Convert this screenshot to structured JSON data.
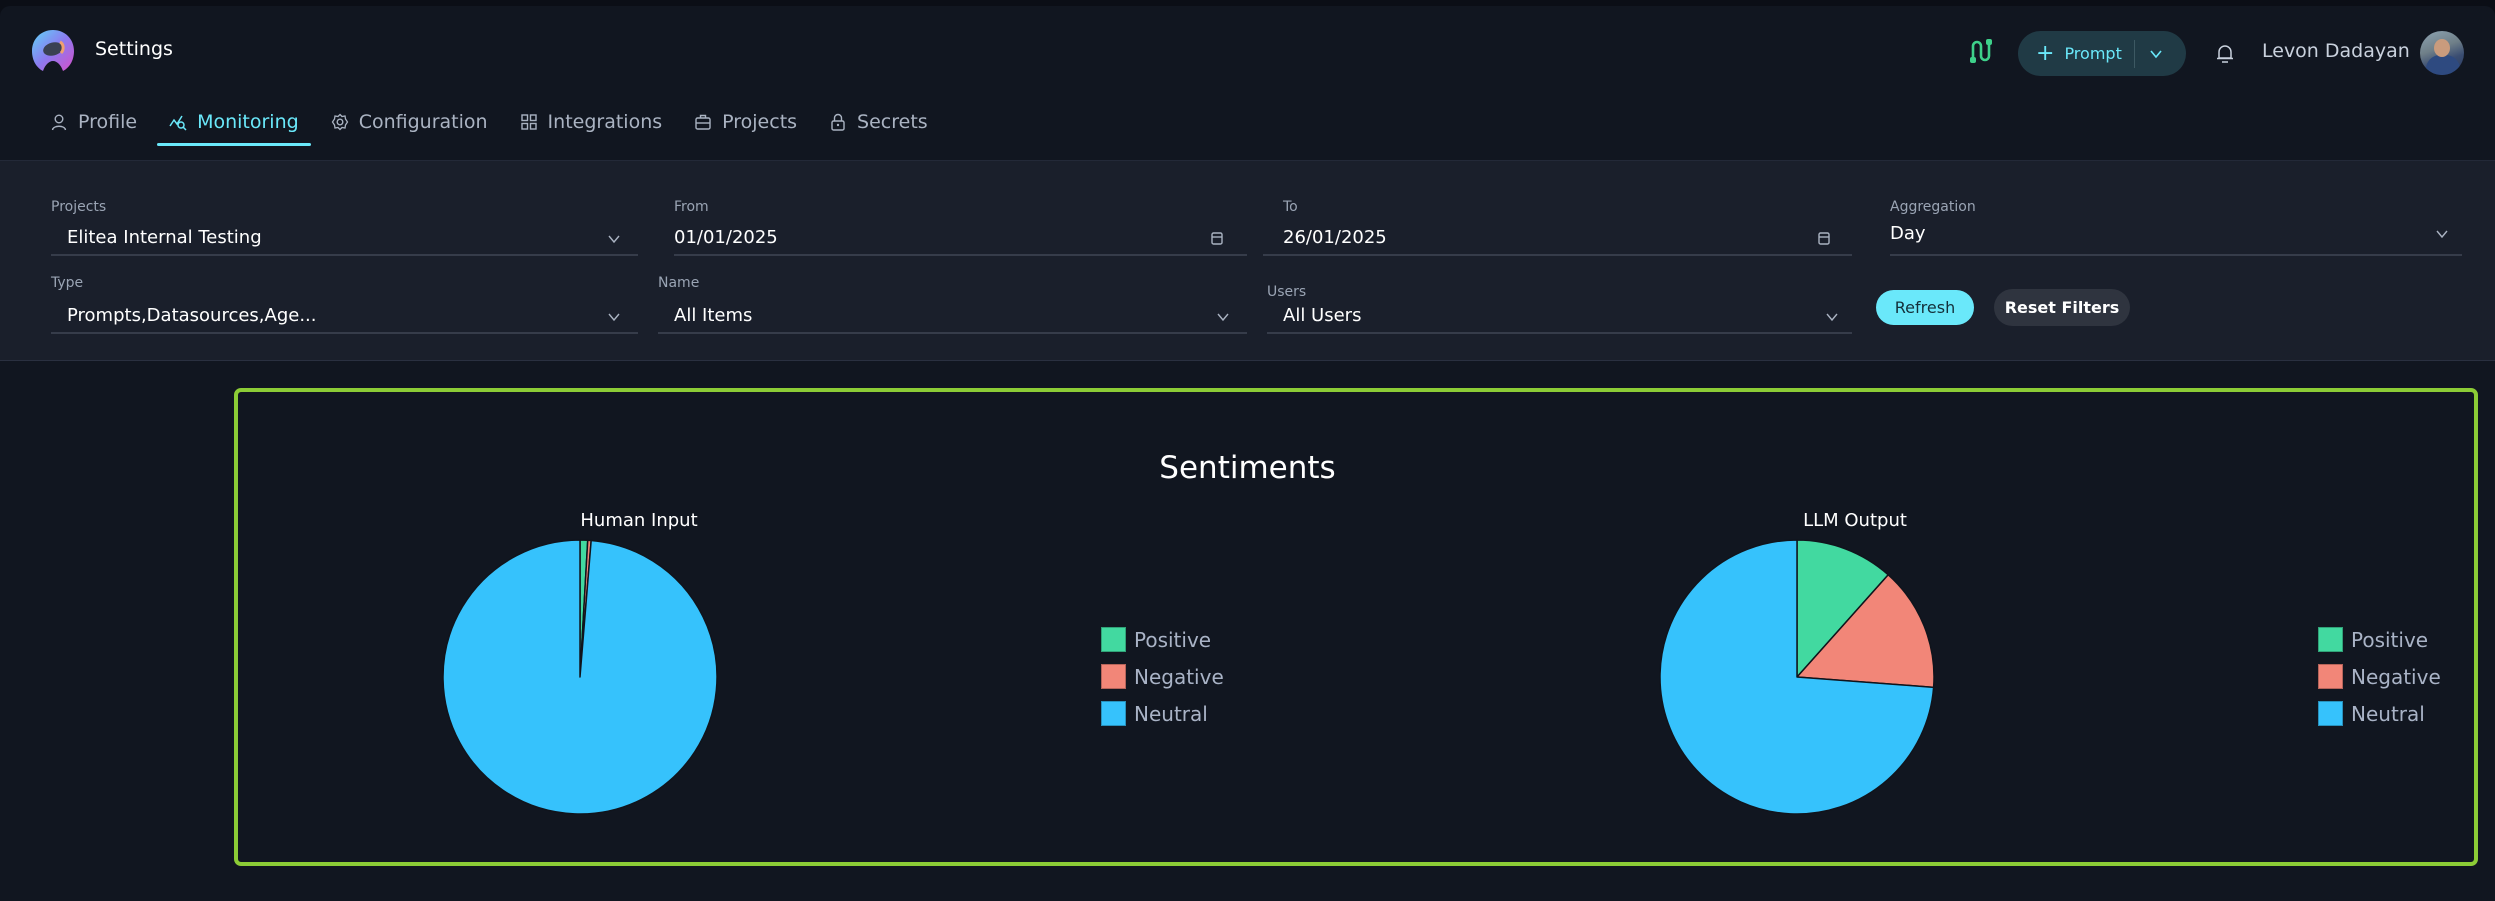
{
  "header": {
    "title": "Settings",
    "prompt_button": {
      "plus": "+",
      "label": "Prompt"
    },
    "user_name": "Levon Dadayan",
    "icons": {
      "logo": "elitea-logo",
      "flow": "flow-icon",
      "bell": "bell-icon",
      "chevron": "chevron-down-icon"
    }
  },
  "tabs": [
    {
      "label": "Profile",
      "icon": "user-icon",
      "active": false
    },
    {
      "label": "Monitoring",
      "icon": "monitoring-icon",
      "active": true
    },
    {
      "label": "Configuration",
      "icon": "gear-icon",
      "active": false
    },
    {
      "label": "Integrations",
      "icon": "grid-icon",
      "active": false
    },
    {
      "label": "Projects",
      "icon": "briefcase-icon",
      "active": false
    },
    {
      "label": "Secrets",
      "icon": "lock-icon",
      "active": false
    }
  ],
  "filters": {
    "projects": {
      "label": "Projects",
      "value": "Elitea Internal Testing"
    },
    "from": {
      "label": "From",
      "value": "01/01/2025"
    },
    "to": {
      "label": "To",
      "value": "26/01/2025"
    },
    "aggregation": {
      "label": "Aggregation",
      "value": "Day"
    },
    "type": {
      "label": "Type",
      "value": "Prompts,Datasources,Age..."
    },
    "name": {
      "label": "Name",
      "value": "All Items"
    },
    "users": {
      "label": "Users",
      "value": "All Users"
    },
    "refresh_label": "Refresh",
    "reset_label": "Reset Filters"
  },
  "colors": {
    "accent": "#6ae8fa",
    "card_border": "#8ccc36",
    "positive": "#42d9a0",
    "negative": "#f28678",
    "neutral": "#36c2fc"
  },
  "chart_data": [
    {
      "type": "pie",
      "title": "Sentiments",
      "subtitle": "Human Input",
      "labels": [
        "Positive",
        "Negative",
        "Neutral"
      ],
      "values": [
        0.9,
        0.4,
        98.7
      ],
      "unit": "%",
      "colors": [
        "#42d9a0",
        "#f28678",
        "#36c2fc"
      ],
      "legend": "right"
    },
    {
      "type": "pie",
      "title": "Sentiments",
      "subtitle": "LLM Output",
      "labels": [
        "Positive",
        "Negative",
        "Neutral"
      ],
      "values": [
        11.6,
        14.6,
        73.8
      ],
      "unit": "%",
      "colors": [
        "#42d9a0",
        "#f28678",
        "#36c2fc"
      ],
      "legend": "right"
    }
  ],
  "card": {
    "title": "Sentiments"
  }
}
